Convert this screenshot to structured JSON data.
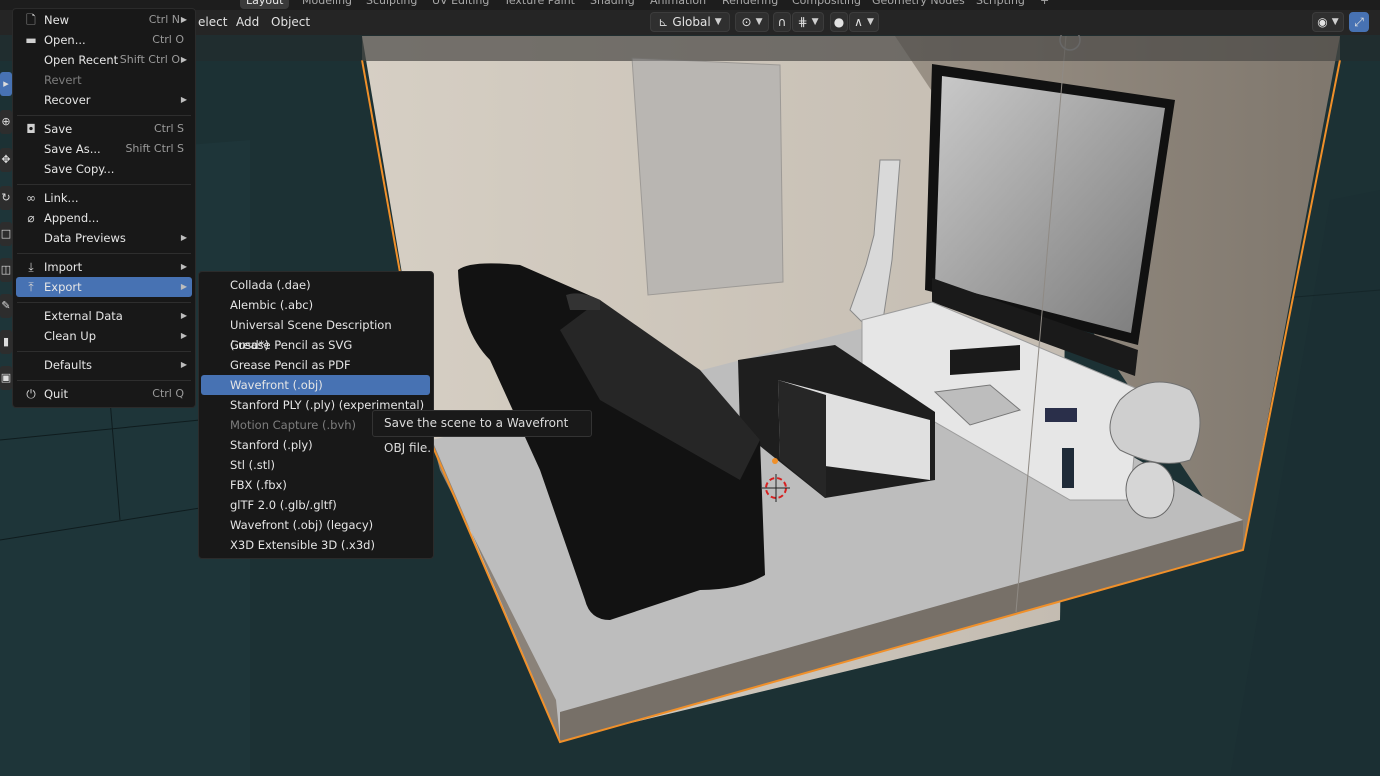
{
  "workspace_tabs": [
    "Layout",
    "Modeling",
    "Sculpting",
    "UV Editing",
    "Texture Paint",
    "Shading",
    "Animation",
    "Rendering",
    "Compositing",
    "Geometry Nodes",
    "Scripting",
    "+"
  ],
  "header": {
    "menus": [
      "elect",
      "Add",
      "Object"
    ],
    "transform_orientation": "Global",
    "pivot_icon": "pivot-icon",
    "snap_icon": "snap-magnet-icon",
    "proportional_icon": "proportional-edit-icon",
    "visibility_icon": "eye-icon",
    "gizmo_icon": "gizmo-icon"
  },
  "file_menu": {
    "items": [
      {
        "label": "New",
        "shortcut": "Ctrl N",
        "icon": "new-file-icon",
        "submenu": true
      },
      {
        "label": "Open...",
        "shortcut": "Ctrl O",
        "icon": "folder-icon"
      },
      {
        "label": "Open Recent",
        "shortcut": "Shift Ctrl O",
        "submenu": true
      },
      {
        "label": "Revert",
        "disabled": true
      },
      {
        "label": "Recover",
        "submenu": true
      },
      {
        "label": "Save",
        "shortcut": "Ctrl S",
        "icon": "save-icon"
      },
      {
        "label": "Save As...",
        "shortcut": "Shift Ctrl S"
      },
      {
        "label": "Save Copy..."
      },
      {
        "label": "Link...",
        "icon": "link-icon"
      },
      {
        "label": "Append...",
        "icon": "append-icon"
      },
      {
        "label": "Data Previews",
        "submenu": true
      },
      {
        "label": "Import",
        "icon": "import-icon",
        "submenu": true
      },
      {
        "label": "Export",
        "icon": "export-icon",
        "submenu": true,
        "highlighted": true
      },
      {
        "label": "External Data",
        "submenu": true
      },
      {
        "label": "Clean Up",
        "submenu": true
      },
      {
        "label": "Defaults",
        "submenu": true
      },
      {
        "label": "Quit",
        "shortcut": "Ctrl Q",
        "icon": "quit-icon"
      }
    ]
  },
  "export_submenu": {
    "items": [
      "Collada (.dae)",
      "Alembic (.abc)",
      "Universal Scene Description (.usd*)",
      "Grease Pencil as SVG",
      "Grease Pencil as PDF",
      "Wavefront (.obj)",
      "Stanford PLY (.ply) (experimental)",
      "Motion Capture (.bvh)",
      "Stanford (.ply)",
      "Stl (.stl)",
      "FBX (.fbx)",
      "glTF 2.0 (.glb/.gltf)",
      "Wavefront (.obj) (legacy)",
      "X3D Extensible 3D (.x3d)"
    ],
    "highlighted_index": 5,
    "disabled_index": 7
  },
  "tooltip": "Save the scene to a Wavefront OBJ file.",
  "colors": {
    "menu_bg": "#181818",
    "highlight": "#4772b3",
    "selection_outline": "#f0902a",
    "viewport_bg": "#1b3135"
  }
}
